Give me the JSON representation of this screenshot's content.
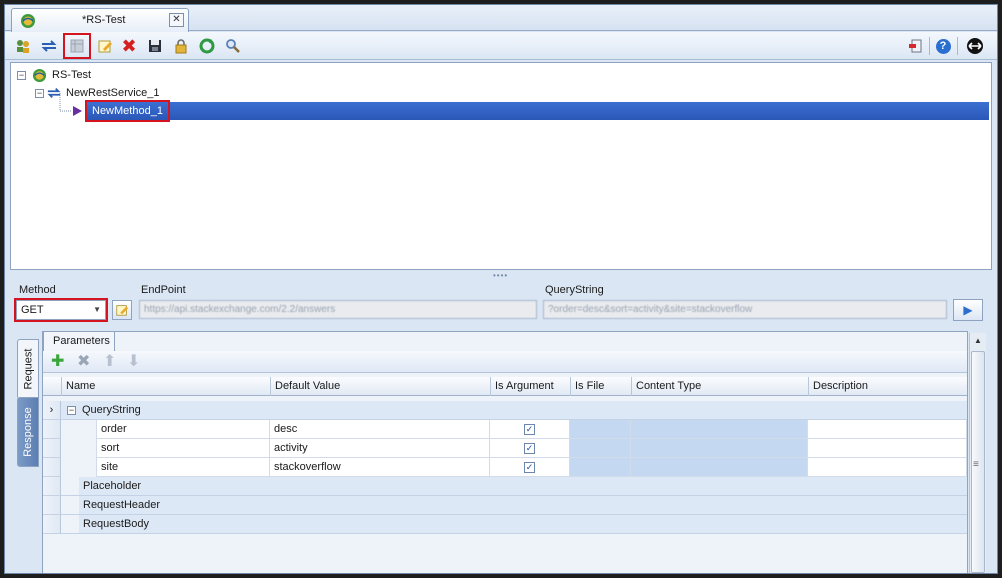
{
  "tab": {
    "title": "*RS-Test",
    "close_glyph": "✕",
    "app_icon": "app-globe-icon"
  },
  "toolbar": {
    "left_icons": [
      "users-icon",
      "refresh-service-icon",
      "disabled-grid-icon",
      "edit-icon",
      "delete-icon",
      "save-icon",
      "lock-icon",
      "refresh-icon",
      "search-icon"
    ],
    "right_icons": [
      "exit-icon",
      "help-icon",
      "dock-icon"
    ],
    "help_glyph": "?"
  },
  "tree": {
    "root_label": "RS-Test",
    "service_label": "NewRestService_1",
    "method_label": "NewMethod_1",
    "collapse_glyph": "−"
  },
  "splitter": "••••",
  "properties": {
    "method_label": "Method",
    "method_value": "GET",
    "endpoint_label": "EndPoint",
    "endpoint_value": "https://api.stackexchange.com/2.2/answers",
    "querystring_label": "QueryString",
    "querystring_value": "?order=desc&sort=activity&site=stackoverflow",
    "run_glyph": "▶"
  },
  "side_tabs": {
    "request": "Request",
    "response": "Response"
  },
  "parameters": {
    "tab_label": "Parameters",
    "add_glyph": "✚",
    "remove_glyph": "✖",
    "up_glyph": "⬆",
    "down_glyph": "⬇",
    "columns": [
      "Name",
      "Default Value",
      "Is Argument",
      "Is File",
      "Content Type",
      "Description"
    ],
    "group_label": "QueryString",
    "row_marker": "›",
    "rows": [
      {
        "name": "order",
        "value": "desc",
        "is_argument": true
      },
      {
        "name": "sort",
        "value": "activity",
        "is_argument": true
      },
      {
        "name": "site",
        "value": "stackoverflow",
        "is_argument": true
      }
    ],
    "groups": [
      "Placeholder",
      "RequestHeader",
      "RequestBody"
    ],
    "check_glyph": "✓"
  },
  "scrollbar": {
    "up_glyph": "▲",
    "grip_glyph": "≡"
  },
  "colors": {
    "accent": "#2a57b8",
    "highlight": "#d4141e",
    "group_band": "#dde8f6"
  }
}
